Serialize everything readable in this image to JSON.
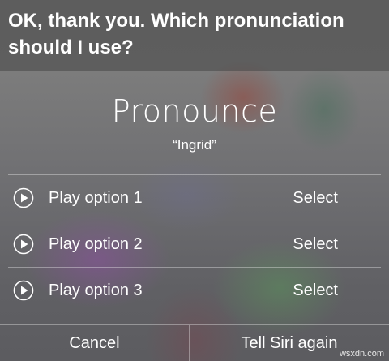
{
  "siri": {
    "question": "OK, thank you. Which pronunciation should I use?"
  },
  "card": {
    "title": "Pronounce",
    "subtitle": "“Ingrid”"
  },
  "options": [
    {
      "play_label": "Play option 1",
      "select_label": "Select",
      "icon": "play-icon"
    },
    {
      "play_label": "Play option 2",
      "select_label": "Select",
      "icon": "play-icon"
    },
    {
      "play_label": "Play option 3",
      "select_label": "Select",
      "icon": "play-icon"
    }
  ],
  "bottom_bar": {
    "cancel_label": "Cancel",
    "again_label": "Tell Siri again"
  },
  "watermark": "wsxdn.com",
  "colors": {
    "text": "#ffffff",
    "divider": "rgba(255,255,255,0.35)"
  }
}
